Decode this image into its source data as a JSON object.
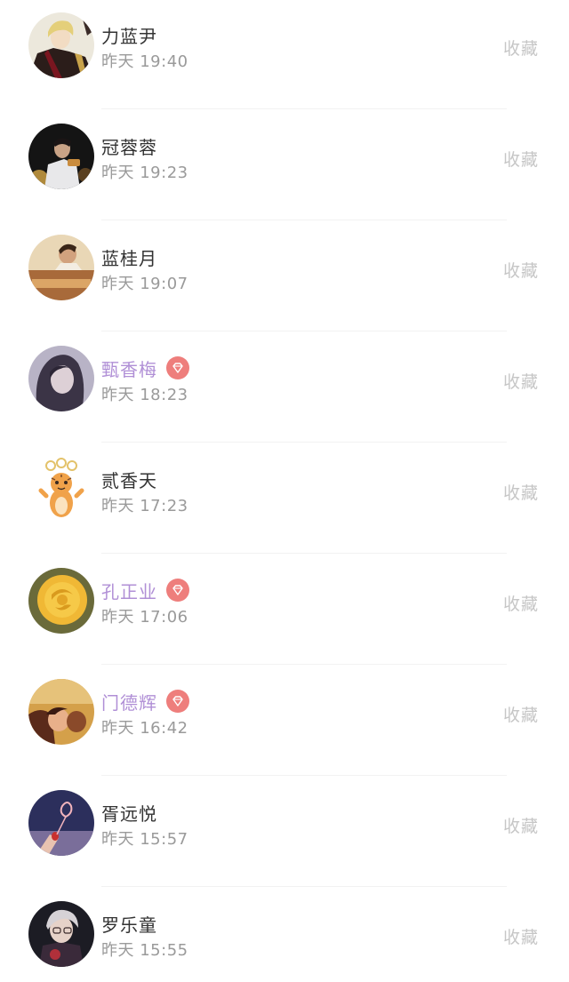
{
  "action_label": "收藏",
  "users": [
    {
      "name": "力蓝尹",
      "time": "昨天 19:40",
      "vip": false
    },
    {
      "name": "冠蓉蓉",
      "time": "昨天 19:23",
      "vip": false
    },
    {
      "name": "蓝桂月",
      "time": "昨天 19:07",
      "vip": false
    },
    {
      "name": "甄香梅",
      "time": "昨天 18:23",
      "vip": true
    },
    {
      "name": "贰香天",
      "time": "昨天 17:23",
      "vip": false
    },
    {
      "name": "孔正业",
      "time": "昨天 17:06",
      "vip": true
    },
    {
      "name": "门德辉",
      "time": "昨天 16:42",
      "vip": true
    },
    {
      "name": "胥远悦",
      "time": "昨天 15:57",
      "vip": false
    },
    {
      "name": "罗乐童",
      "time": "昨天 15:55",
      "vip": false
    }
  ],
  "colors": {
    "vip_name": "#b08fd6",
    "vip_badge": "#ee7e7c",
    "action": "#c6c6c6",
    "time": "#9a9a9a"
  }
}
